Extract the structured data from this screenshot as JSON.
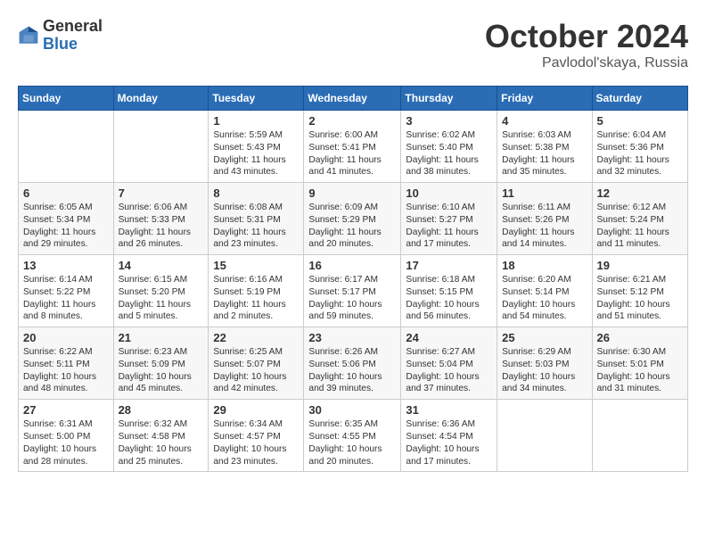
{
  "logo": {
    "general": "General",
    "blue": "Blue"
  },
  "title": "October 2024",
  "location": "Pavlodol'skaya, Russia",
  "weekdays": [
    "Sunday",
    "Monday",
    "Tuesday",
    "Wednesday",
    "Thursday",
    "Friday",
    "Saturday"
  ],
  "weeks": [
    [
      {
        "day": "",
        "sunrise": "",
        "sunset": "",
        "daylight": ""
      },
      {
        "day": "",
        "sunrise": "",
        "sunset": "",
        "daylight": ""
      },
      {
        "day": "1",
        "sunrise": "Sunrise: 5:59 AM",
        "sunset": "Sunset: 5:43 PM",
        "daylight": "Daylight: 11 hours and 43 minutes."
      },
      {
        "day": "2",
        "sunrise": "Sunrise: 6:00 AM",
        "sunset": "Sunset: 5:41 PM",
        "daylight": "Daylight: 11 hours and 41 minutes."
      },
      {
        "day": "3",
        "sunrise": "Sunrise: 6:02 AM",
        "sunset": "Sunset: 5:40 PM",
        "daylight": "Daylight: 11 hours and 38 minutes."
      },
      {
        "day": "4",
        "sunrise": "Sunrise: 6:03 AM",
        "sunset": "Sunset: 5:38 PM",
        "daylight": "Daylight: 11 hours and 35 minutes."
      },
      {
        "day": "5",
        "sunrise": "Sunrise: 6:04 AM",
        "sunset": "Sunset: 5:36 PM",
        "daylight": "Daylight: 11 hours and 32 minutes."
      }
    ],
    [
      {
        "day": "6",
        "sunrise": "Sunrise: 6:05 AM",
        "sunset": "Sunset: 5:34 PM",
        "daylight": "Daylight: 11 hours and 29 minutes."
      },
      {
        "day": "7",
        "sunrise": "Sunrise: 6:06 AM",
        "sunset": "Sunset: 5:33 PM",
        "daylight": "Daylight: 11 hours and 26 minutes."
      },
      {
        "day": "8",
        "sunrise": "Sunrise: 6:08 AM",
        "sunset": "Sunset: 5:31 PM",
        "daylight": "Daylight: 11 hours and 23 minutes."
      },
      {
        "day": "9",
        "sunrise": "Sunrise: 6:09 AM",
        "sunset": "Sunset: 5:29 PM",
        "daylight": "Daylight: 11 hours and 20 minutes."
      },
      {
        "day": "10",
        "sunrise": "Sunrise: 6:10 AM",
        "sunset": "Sunset: 5:27 PM",
        "daylight": "Daylight: 11 hours and 17 minutes."
      },
      {
        "day": "11",
        "sunrise": "Sunrise: 6:11 AM",
        "sunset": "Sunset: 5:26 PM",
        "daylight": "Daylight: 11 hours and 14 minutes."
      },
      {
        "day": "12",
        "sunrise": "Sunrise: 6:12 AM",
        "sunset": "Sunset: 5:24 PM",
        "daylight": "Daylight: 11 hours and 11 minutes."
      }
    ],
    [
      {
        "day": "13",
        "sunrise": "Sunrise: 6:14 AM",
        "sunset": "Sunset: 5:22 PM",
        "daylight": "Daylight: 11 hours and 8 minutes."
      },
      {
        "day": "14",
        "sunrise": "Sunrise: 6:15 AM",
        "sunset": "Sunset: 5:20 PM",
        "daylight": "Daylight: 11 hours and 5 minutes."
      },
      {
        "day": "15",
        "sunrise": "Sunrise: 6:16 AM",
        "sunset": "Sunset: 5:19 PM",
        "daylight": "Daylight: 11 hours and 2 minutes."
      },
      {
        "day": "16",
        "sunrise": "Sunrise: 6:17 AM",
        "sunset": "Sunset: 5:17 PM",
        "daylight": "Daylight: 10 hours and 59 minutes."
      },
      {
        "day": "17",
        "sunrise": "Sunrise: 6:18 AM",
        "sunset": "Sunset: 5:15 PM",
        "daylight": "Daylight: 10 hours and 56 minutes."
      },
      {
        "day": "18",
        "sunrise": "Sunrise: 6:20 AM",
        "sunset": "Sunset: 5:14 PM",
        "daylight": "Daylight: 10 hours and 54 minutes."
      },
      {
        "day": "19",
        "sunrise": "Sunrise: 6:21 AM",
        "sunset": "Sunset: 5:12 PM",
        "daylight": "Daylight: 10 hours and 51 minutes."
      }
    ],
    [
      {
        "day": "20",
        "sunrise": "Sunrise: 6:22 AM",
        "sunset": "Sunset: 5:11 PM",
        "daylight": "Daylight: 10 hours and 48 minutes."
      },
      {
        "day": "21",
        "sunrise": "Sunrise: 6:23 AM",
        "sunset": "Sunset: 5:09 PM",
        "daylight": "Daylight: 10 hours and 45 minutes."
      },
      {
        "day": "22",
        "sunrise": "Sunrise: 6:25 AM",
        "sunset": "Sunset: 5:07 PM",
        "daylight": "Daylight: 10 hours and 42 minutes."
      },
      {
        "day": "23",
        "sunrise": "Sunrise: 6:26 AM",
        "sunset": "Sunset: 5:06 PM",
        "daylight": "Daylight: 10 hours and 39 minutes."
      },
      {
        "day": "24",
        "sunrise": "Sunrise: 6:27 AM",
        "sunset": "Sunset: 5:04 PM",
        "daylight": "Daylight: 10 hours and 37 minutes."
      },
      {
        "day": "25",
        "sunrise": "Sunrise: 6:29 AM",
        "sunset": "Sunset: 5:03 PM",
        "daylight": "Daylight: 10 hours and 34 minutes."
      },
      {
        "day": "26",
        "sunrise": "Sunrise: 6:30 AM",
        "sunset": "Sunset: 5:01 PM",
        "daylight": "Daylight: 10 hours and 31 minutes."
      }
    ],
    [
      {
        "day": "27",
        "sunrise": "Sunrise: 6:31 AM",
        "sunset": "Sunset: 5:00 PM",
        "daylight": "Daylight: 10 hours and 28 minutes."
      },
      {
        "day": "28",
        "sunrise": "Sunrise: 6:32 AM",
        "sunset": "Sunset: 4:58 PM",
        "daylight": "Daylight: 10 hours and 25 minutes."
      },
      {
        "day": "29",
        "sunrise": "Sunrise: 6:34 AM",
        "sunset": "Sunset: 4:57 PM",
        "daylight": "Daylight: 10 hours and 23 minutes."
      },
      {
        "day": "30",
        "sunrise": "Sunrise: 6:35 AM",
        "sunset": "Sunset: 4:55 PM",
        "daylight": "Daylight: 10 hours and 20 minutes."
      },
      {
        "day": "31",
        "sunrise": "Sunrise: 6:36 AM",
        "sunset": "Sunset: 4:54 PM",
        "daylight": "Daylight: 10 hours and 17 minutes."
      },
      {
        "day": "",
        "sunrise": "",
        "sunset": "",
        "daylight": ""
      },
      {
        "day": "",
        "sunrise": "",
        "sunset": "",
        "daylight": ""
      }
    ]
  ]
}
